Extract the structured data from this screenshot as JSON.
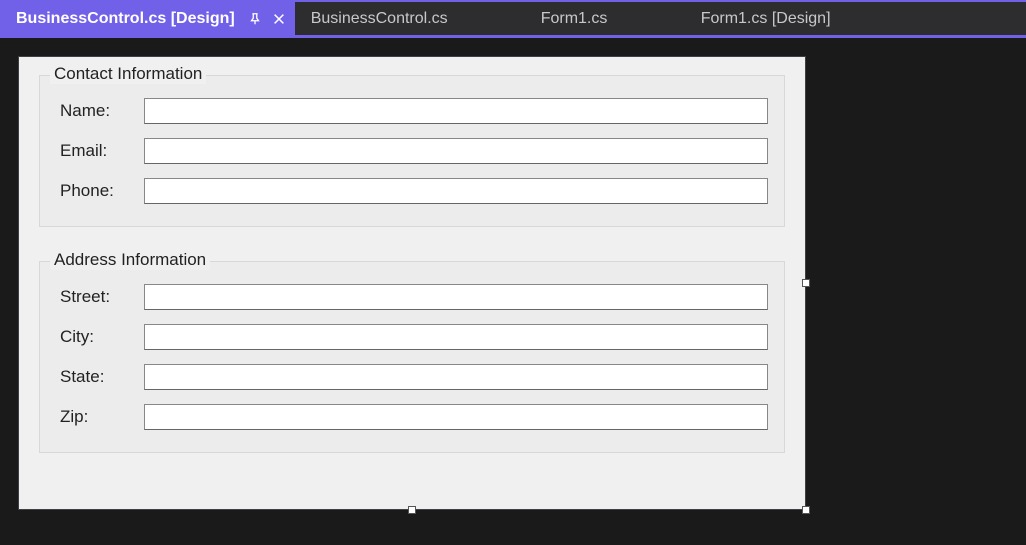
{
  "tabs": [
    {
      "label": "BusinessControl.cs [Design]",
      "active": true
    },
    {
      "label": "BusinessControl.cs",
      "active": false
    },
    {
      "label": "Form1.cs",
      "active": false
    },
    {
      "label": "Form1.cs [Design]",
      "active": false
    }
  ],
  "contact_group": {
    "title": "Contact Information",
    "fields": [
      {
        "label": "Name:",
        "value": ""
      },
      {
        "label": "Email:",
        "value": ""
      },
      {
        "label": "Phone:",
        "value": ""
      }
    ]
  },
  "address_group": {
    "title": "Address Information",
    "fields": [
      {
        "label": "Street:",
        "value": ""
      },
      {
        "label": "City:",
        "value": ""
      },
      {
        "label": "State:",
        "value": ""
      },
      {
        "label": "Zip:",
        "value": ""
      }
    ]
  }
}
